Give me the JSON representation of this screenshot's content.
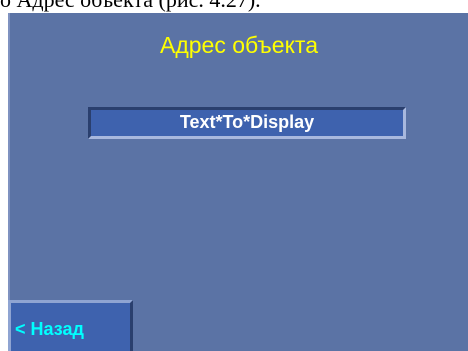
{
  "caption": {
    "text": "о Адрес объекта (рис. 4.27)."
  },
  "screen": {
    "title": "Адрес объекта",
    "value_field": "Text*To*Display",
    "back_button_label": "< Назад"
  },
  "colors": {
    "background": "#5b73a5",
    "title": "#ffff00",
    "field_bg": "#3e62ae",
    "field_text": "#ffffff",
    "button_text": "#00ffff"
  }
}
